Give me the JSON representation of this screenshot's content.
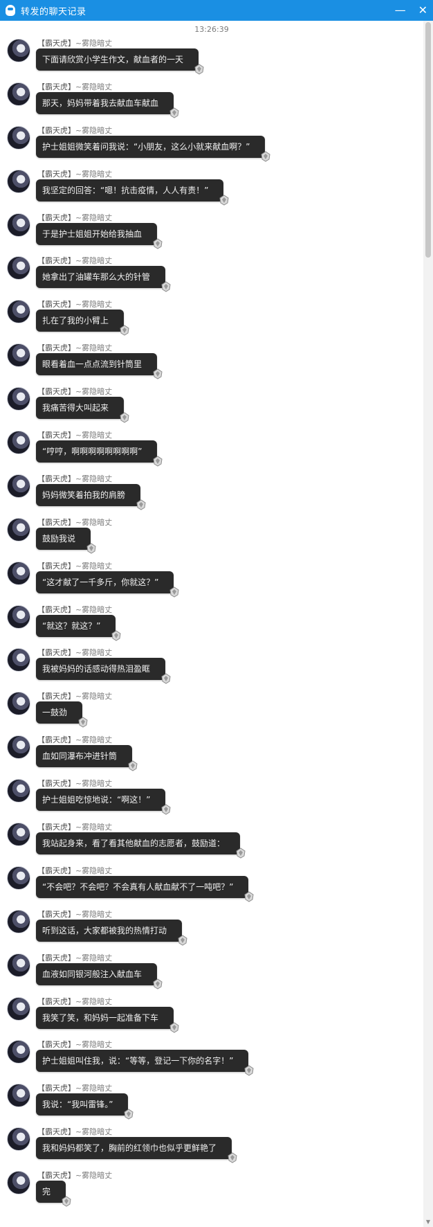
{
  "window": {
    "title": "转发的聊天记录",
    "minimize": "—",
    "close": "✕"
  },
  "timestamp": "13:26:39",
  "sender": {
    "tag": "【霸天虎】",
    "name": "~雾隐暗丈"
  },
  "messages": [
    "下面请欣赏小学生作文，献血者的一天",
    "那天，妈妈带着我去献血车献血",
    "护士姐姐微笑着问我说：“小朋友，这么小就来献血啊？”",
    "我坚定的回答：“嗯！抗击疫情，人人有责！”",
    "于是护士姐姐开始给我抽血",
    "她拿出了油罐车那么大的针管",
    "扎在了我的小臂上",
    "眼看着血一点点流到针筒里",
    "我痛苦得大叫起来",
    "“哼哼，啊啊啊啊啊啊啊啊”",
    "妈妈微笑着拍我的肩膀",
    "鼓励我说",
    "“这才献了一千多斤，你就这？”",
    "“就这？就这？”",
    "我被妈妈的话感动得热泪盈眶",
    "一鼓劲",
    "血如同瀑布冲进针筒",
    "护士姐姐吃惊地说：“啊这！”",
    "我站起身来，看了看其他献血的志愿者，鼓励道：",
    "“不会吧？不会吧？不会真有人献血献不了一吨吧？”",
    "听到这话，大家都被我的热情打动",
    "血液如同银河般注入献血车",
    "我笑了笑，和妈妈一起准备下车",
    "护士姐姐叫住我，说：“等等，登记一下你的名字！”",
    "我说：“我叫雷锋。”",
    "我和妈妈都笑了，胸前的红领巾也似乎更鲜艳了",
    "完"
  ],
  "scroll": {
    "up": "▲",
    "down": "▼",
    "position": 0
  }
}
